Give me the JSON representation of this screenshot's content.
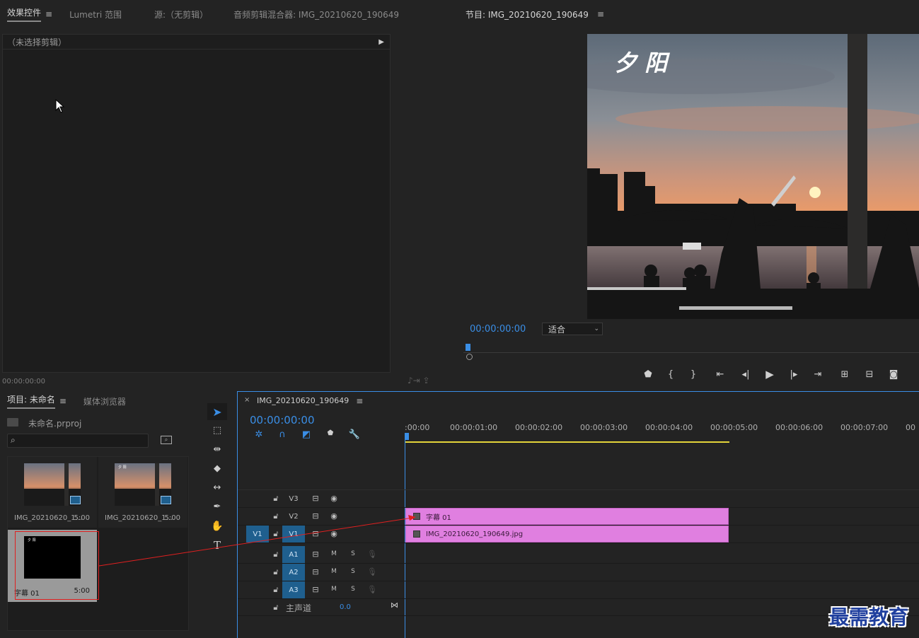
{
  "effects_panel": {
    "tabs": [
      "效果控件",
      "Lumetri 范围",
      "源:（无剪辑）",
      "音频剪辑混合器: IMG_20210620_190649"
    ],
    "no_clip": "（未选择剪辑）",
    "timecode": "00:00:00:00"
  },
  "program_monitor": {
    "title": "节目: IMG_20210620_190649",
    "timecode": "00:00:00:00",
    "fit": "适合",
    "overlay_title": "夕 阳"
  },
  "project_panel": {
    "tabs": [
      "项目: 未命名",
      "媒体浏览器"
    ],
    "project_file": "未命名.prproj",
    "items": [
      {
        "name": "IMG_20210620_1...",
        "duration": "5:00"
      },
      {
        "name": "IMG_20210620_1...",
        "duration": "5:00"
      },
      {
        "name": "字幕 01",
        "duration": "5:00"
      }
    ],
    "thumb_text": "夕 阳"
  },
  "timeline": {
    "title": "IMG_20210620_190649",
    "timecode": "00:00:00:00",
    "ruler": [
      ":00:00",
      "00:00:01:00",
      "00:00:02:00",
      "00:00:03:00",
      "00:00:04:00",
      "00:00:05:00",
      "00:00:06:00",
      "00:00:07:00",
      "00"
    ],
    "video_tracks": [
      "V3",
      "V2",
      "V1"
    ],
    "audio_tracks": [
      "A1",
      "A2",
      "A3"
    ],
    "source_patch": "V1",
    "master": "主声道",
    "master_value": "0.0",
    "clip_title": "字幕 01",
    "clip_image": "IMG_20210620_190649.jpg",
    "m": "M",
    "s": "S"
  },
  "watermark": "最需教育",
  "colors": {
    "accent": "#3a8ee6",
    "clip": "#e07fe0",
    "panel": "#1d1d1d",
    "track_on": "#1f5f8e"
  }
}
